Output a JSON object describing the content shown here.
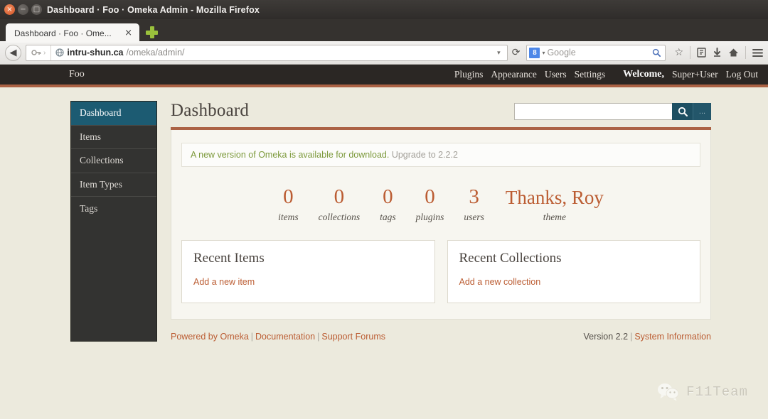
{
  "browser": {
    "window_title": "Dashboard · Foo · Omeka Admin - Mozilla Firefox",
    "window_controls": {
      "close": "×",
      "minimize": "−",
      "maximize": "□"
    },
    "tab": {
      "label": "Dashboard · Foo · Ome...",
      "close": "×"
    },
    "new_tab_icon": "plus-icon",
    "back_icon": "◀",
    "identity_icon": "key-icon",
    "site_icon": "globe-icon",
    "url_host": "intru-shun.ca",
    "url_path": "/omeka/admin/",
    "url_dropdown": "▾",
    "reload_icon": "⟳",
    "search_engine": "8",
    "search_caret": "▾",
    "search_placeholder": "Google",
    "search_magnifier": "search-icon",
    "toolbar_icons": [
      "star-icon",
      "bookmarks-icon",
      "downloads-icon",
      "home-icon",
      "menu-icon"
    ]
  },
  "adminbar": {
    "site_title": "Foo",
    "links": [
      "Plugins",
      "Appearance",
      "Users",
      "Settings"
    ],
    "welcome": "Welcome,",
    "username": "Super+User",
    "logout": "Log Out"
  },
  "sidebar": {
    "items": [
      {
        "label": "Dashboard",
        "active": true
      },
      {
        "label": "Items",
        "active": false
      },
      {
        "label": "Collections",
        "active": false
      },
      {
        "label": "Item Types",
        "active": false
      },
      {
        "label": "Tags",
        "active": false
      }
    ]
  },
  "main": {
    "page_title": "Dashboard",
    "search": {
      "value": "",
      "placeholder": "",
      "button_icon": "search-icon",
      "options_label": "..."
    },
    "notice": {
      "message": "A new version of Omeka is available for download.",
      "upgrade": "Upgrade to 2.2.2"
    },
    "stats": [
      {
        "num": "0",
        "label": "items"
      },
      {
        "num": "0",
        "label": "collections"
      },
      {
        "num": "0",
        "label": "tags"
      },
      {
        "num": "0",
        "label": "plugins"
      },
      {
        "num": "3",
        "label": "users"
      },
      {
        "num": "Thanks, Roy",
        "label": "theme"
      }
    ],
    "cards": [
      {
        "title": "Recent Items",
        "link": "Add a new item"
      },
      {
        "title": "Recent Collections",
        "link": "Add a new collection"
      }
    ]
  },
  "footer": {
    "powered_by": "Powered by Omeka",
    "documentation": "Documentation",
    "support": "Support Forums",
    "version": "Version 2.2",
    "system_info": "System Information",
    "separator": "|"
  },
  "watermark": {
    "text": "F11Team",
    "icon": "wechat-icon"
  },
  "colors": {
    "accent_rust": "#ab6244",
    "link_orange": "#bb5c32",
    "sidebar_active": "#1c5b72",
    "notice_green": "#7d9a3c",
    "page_bg": "#eceadd"
  }
}
